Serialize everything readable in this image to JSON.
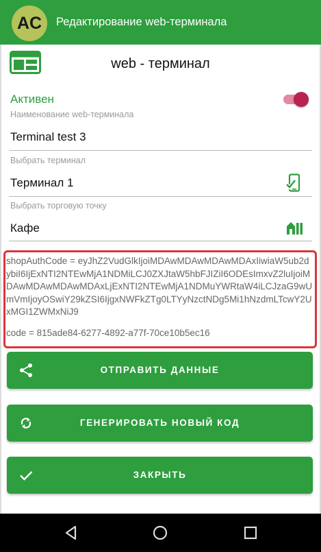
{
  "appbar": {
    "avatar_initials": "AC",
    "title": "Редактирование web-терминала"
  },
  "header": {
    "title": "web - терминал",
    "icon": "web-terminal-icon"
  },
  "status": {
    "active_label": "Активен",
    "active": true
  },
  "fields": {
    "name": {
      "hint": "Наименование web-терминала",
      "value": "Terminal test 3"
    },
    "terminal": {
      "hint": "Выбрать терминал",
      "value": "Терминал 1",
      "icon": "phone-check-icon"
    },
    "store": {
      "hint": "Выбрать торговую точку",
      "value": "Кафе",
      "icon": "store-icon"
    }
  },
  "code_block": {
    "shop_auth_code": "shopAuthCode =  eyJhZ2VudGlkIjoiMDAwMDAwMDAwMDAxIiwiaW5ub2dybiI6IjExNTI2NTEwMjA1NDMiLCJ0ZXJtaW5hbFJIZiI6ODEsImxvZ2luIjoiMDAwMDAwMDAwMDAxLjExNTI2NTEwMjA1NDMuYWRtaW4iLCJzaG9wUmVmIjoyOSwiY29kZSI6IjgxNWFkZTg0LTYyNzctNDg5Mi1hNzdmLTcwY2UxMGI1ZWMxNiJ9",
    "code": "code =  815ade84-6277-4892-a77f-70ce10b5ec16"
  },
  "buttons": {
    "send": {
      "label": "ОТПРАВИТЬ ДАННЫЕ",
      "icon": "share-icon"
    },
    "generate": {
      "label": "ГЕНЕРИРОВАТЬ НОВЫЙ КОД",
      "icon": "refresh-icon"
    },
    "close": {
      "label": "ЗАКРЫТЬ",
      "icon": "check-icon"
    }
  },
  "navbar": {
    "back": "back-icon",
    "home": "home-icon",
    "recents": "recents-icon"
  },
  "colors": {
    "primary": "#2e9e3e",
    "switch_knob": "#b8234f",
    "switch_track": "#e38aa3",
    "highlight_border": "#d9353a"
  }
}
